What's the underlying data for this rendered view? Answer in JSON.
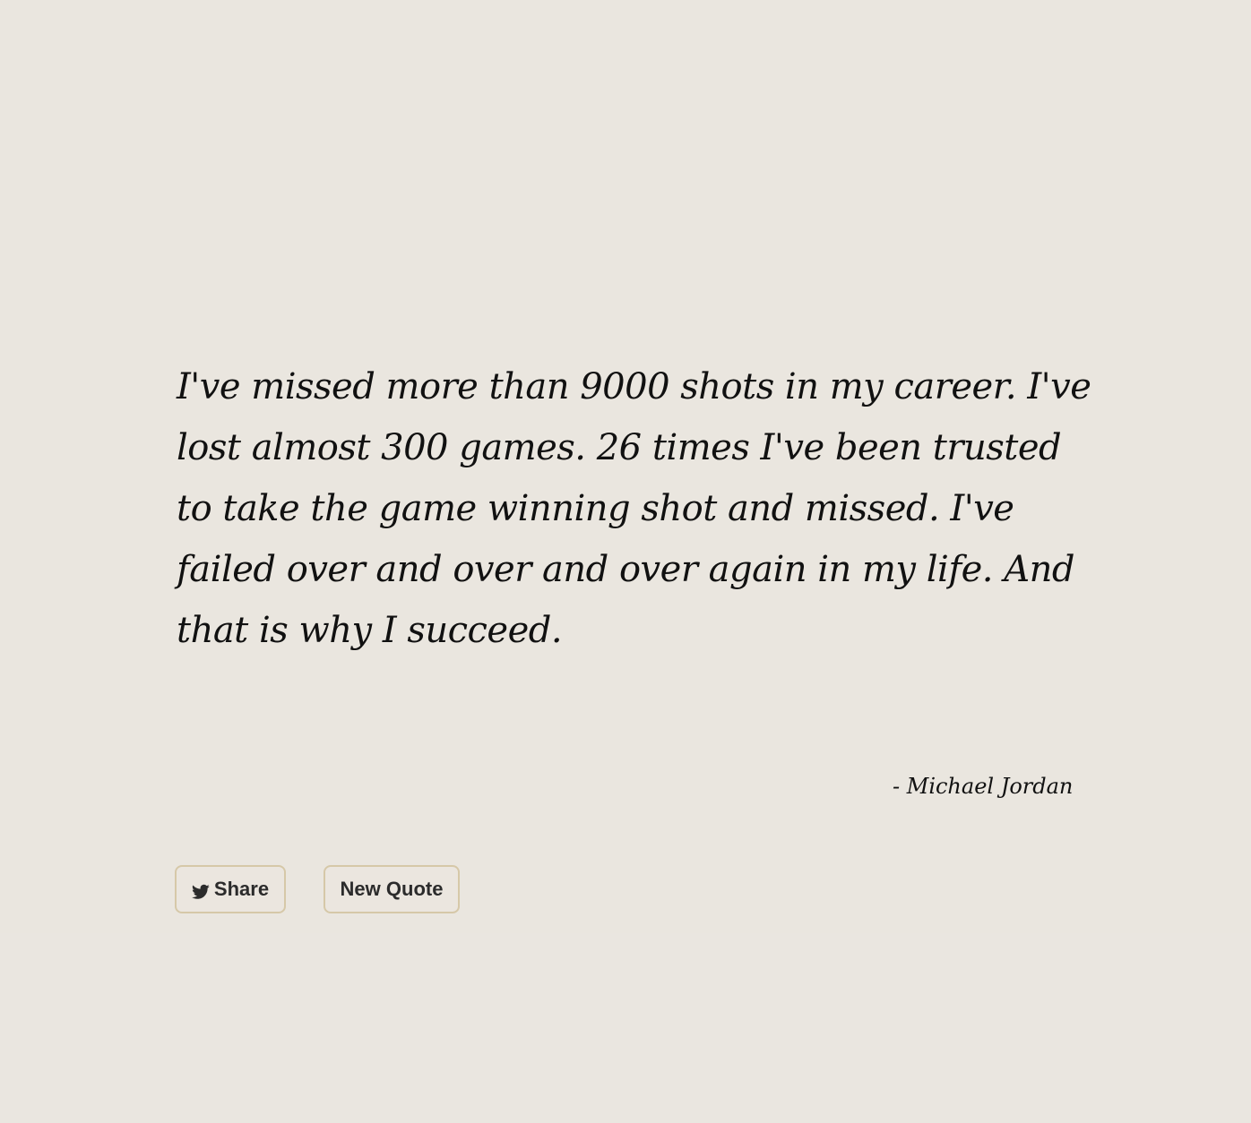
{
  "quote": {
    "text": "I've missed more than 9000 shots in my career. I've lost almost 300 games. 26 times I've been trusted to take the game winning shot and missed. I've failed over and over and over again in my life. And that is why I succeed.",
    "author": "- Michael Jordan"
  },
  "actions": {
    "share_label": "Share",
    "share_icon": "twitter-bird-icon",
    "new_quote_label": "New Quote"
  },
  "colors": {
    "background": "#eae6df",
    "button_border": "#d6c8a8",
    "text": "#111111"
  }
}
